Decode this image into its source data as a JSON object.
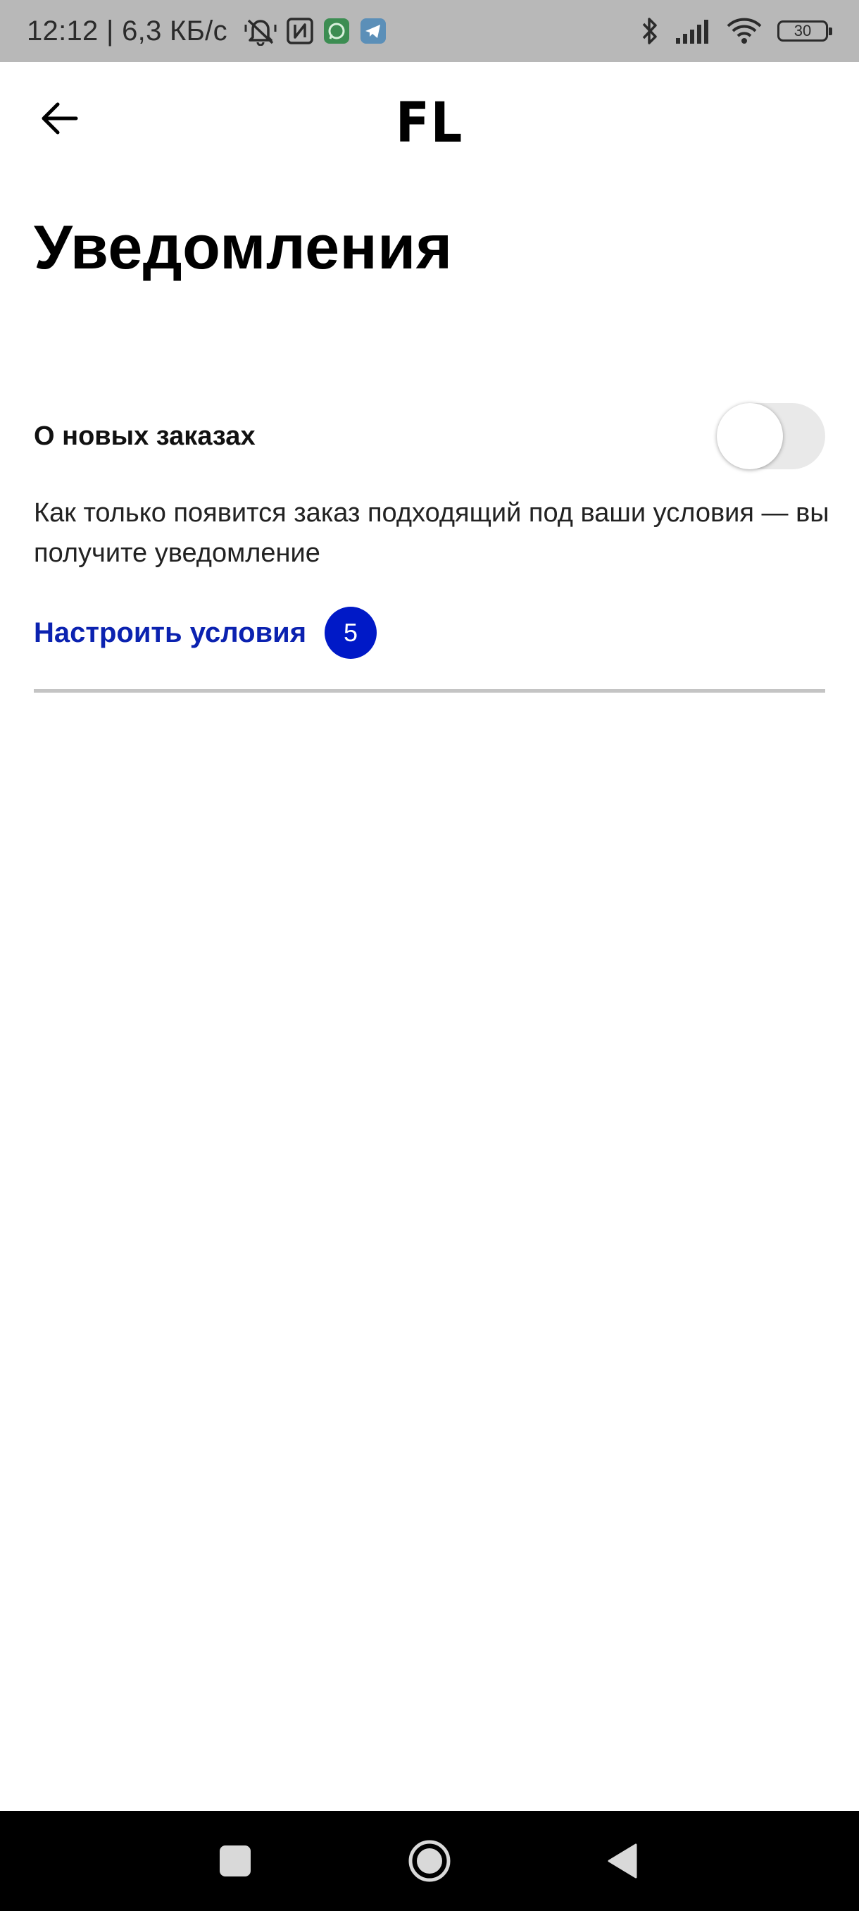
{
  "status_bar": {
    "time_speed": "12:12 | 6,3 КБ/с",
    "battery_level": "30",
    "left_icons": [
      "mute-icon",
      "nfc-icon",
      "whatsapp-icon",
      "telegram-icon"
    ],
    "right_icons": [
      "bluetooth-icon",
      "signal-icon",
      "wifi-icon",
      "battery-icon"
    ]
  },
  "app_bar": {
    "logo": "FL",
    "back_icon": "arrow-left-icon"
  },
  "page": {
    "title": "Уведомления"
  },
  "notification_setting": {
    "label": "О новых заказах",
    "enabled": false,
    "description": "Как только появится заказ подходящий под ваши условия — вы получите уведомление",
    "configure_label": "Настроить условия",
    "conditions_count": "5"
  },
  "colors": {
    "accent": "#0019c7",
    "link": "#0b22b0",
    "status_bar": "#b8b8b8",
    "toggle_track": "#e9e9e9",
    "nav_bar": "#000000"
  },
  "nav_bar": {
    "buttons": [
      "recents-icon",
      "home-icon",
      "back-triangle-icon"
    ]
  }
}
